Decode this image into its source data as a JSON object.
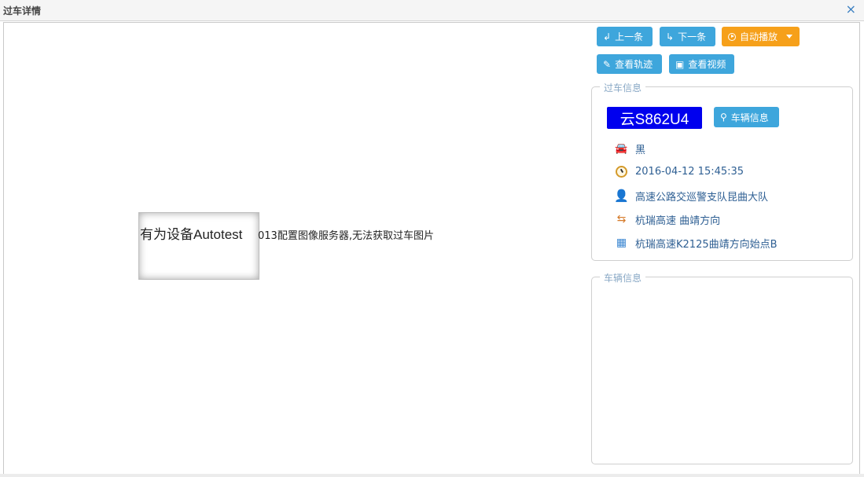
{
  "window": {
    "title": "过车详情",
    "close_glyph": "×"
  },
  "image_area": {
    "message_main": "有为设备Autotest",
    "message_rest": "013配置图像服务器,无法获取过车图片"
  },
  "toolbar": {
    "prev_label": "上一条",
    "next_label": "下一条",
    "autoplay_label": "自动播放",
    "track_label": "查看轨迹",
    "video_label": "查看视频"
  },
  "pass_info": {
    "legend": "过车信息",
    "plate": "云S862U4",
    "plate_color": "#0000ee",
    "vehicle_info_button": "车辆信息",
    "color": "黑",
    "time": "2016-04-12 15:45:35",
    "department": "高速公路交巡警支队昆曲大队",
    "road": "杭瑞高速 曲靖方向",
    "location": "杭瑞高速K2125曲靖方向始点B"
  },
  "vehicle_info": {
    "legend": "车辆信息"
  },
  "colors": {
    "button_blue": "#3ea6dc",
    "button_orange": "#f6a01a",
    "info_text": "#2e5f93"
  },
  "icons": {
    "prev": "return-arrow-icon",
    "next": "turn-arrow-icon",
    "autoplay": "play-circle-icon",
    "track": "pin-icon",
    "video": "film-icon",
    "search": "search-icon",
    "car": "car-icon",
    "clock": "clock-icon",
    "user": "user-icon",
    "road": "signpost-icon",
    "location": "map-icon"
  }
}
